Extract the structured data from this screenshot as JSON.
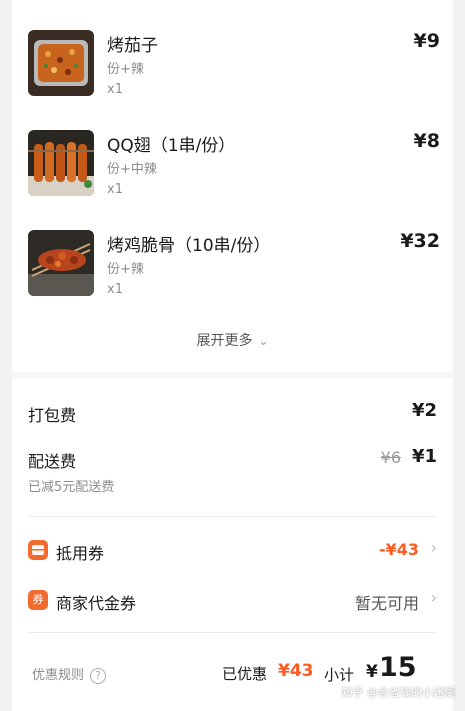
{
  "items": [
    {
      "name": "烤茄子",
      "spec": "份+辣",
      "qty": "x1",
      "price": "¥9"
    },
    {
      "name": "QQ翅（1串/份）",
      "spec": "份+中辣",
      "qty": "x1",
      "price": "¥8"
    },
    {
      "name": "烤鸡脆骨（10串/份）",
      "spec": "份+辣",
      "qty": "x1",
      "price": "¥32"
    }
  ],
  "expand": {
    "label": "展开更多",
    "icon": "chevron-down-icon"
  },
  "fees": {
    "packing_label": "打包费",
    "packing_value": "¥2",
    "delivery_label": "配送费",
    "delivery_original": "¥6",
    "delivery_value": "¥1",
    "delivery_note": "已减5元配送费"
  },
  "coupon": {
    "icon_text": "",
    "label": "抵用券",
    "value": "-¥43"
  },
  "voucher": {
    "icon_text": "券",
    "label": "商家代金券",
    "value": "暂无可用"
  },
  "footer": {
    "rules_label": "优惠规则",
    "rules_icon": "?",
    "saved_label": "已优惠",
    "saved_value": "¥43",
    "subtotal_label": "小计",
    "subtotal_yen": "¥",
    "subtotal_value": "15"
  },
  "watermark": "知乎 @会省钱的小迷糊",
  "colors": {
    "accent": "#ff5a1f",
    "icon_bg": "#f26b2e"
  }
}
